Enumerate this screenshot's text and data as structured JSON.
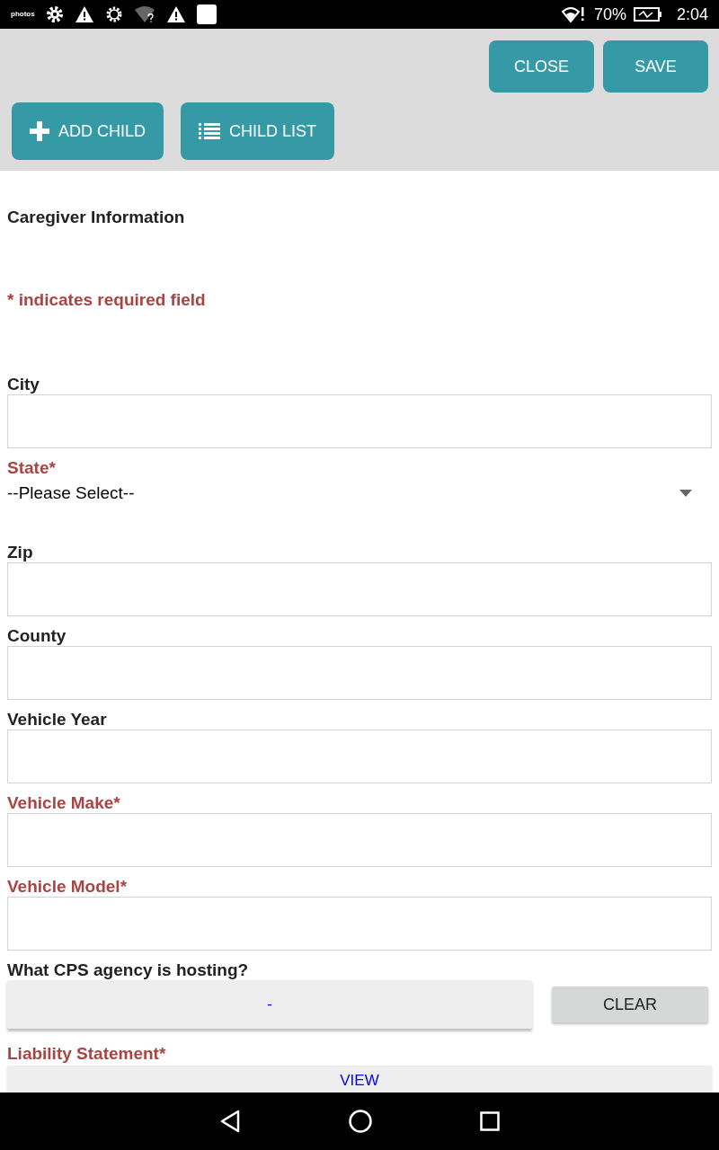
{
  "status_bar": {
    "app_label": "photos",
    "battery": "70%",
    "time": "2:04"
  },
  "toolbar": {
    "top_buttons": [
      "CLOSE",
      "SAVE"
    ],
    "bottom_buttons": [
      {
        "label": "ADD CHILD",
        "kind": "add"
      },
      {
        "label": "CHILD LIST",
        "kind": "list"
      }
    ]
  },
  "form": {
    "title": "Caregiver Information",
    "required_note": "* indicates required field",
    "fields": [
      {
        "kind": "text",
        "label": "City",
        "required": false
      },
      {
        "kind": "select",
        "label": "State*",
        "required": true,
        "value": "--Please Select--"
      },
      {
        "kind": "text",
        "label": "Zip",
        "required": false
      },
      {
        "kind": "text",
        "label": "County",
        "required": false
      },
      {
        "kind": "text",
        "label": "Vehicle Year",
        "required": false
      },
      {
        "kind": "text",
        "label": "Vehicle Make*",
        "required": true
      },
      {
        "kind": "text",
        "label": "Vehicle Model*",
        "required": true
      },
      {
        "kind": "lookup",
        "label": "What CPS agency is hosting?",
        "required": false,
        "value": "-",
        "clear": "CLEAR"
      },
      {
        "kind": "button",
        "label": "Liability Statement*",
        "required": true,
        "value": "VIEW"
      }
    ]
  }
}
